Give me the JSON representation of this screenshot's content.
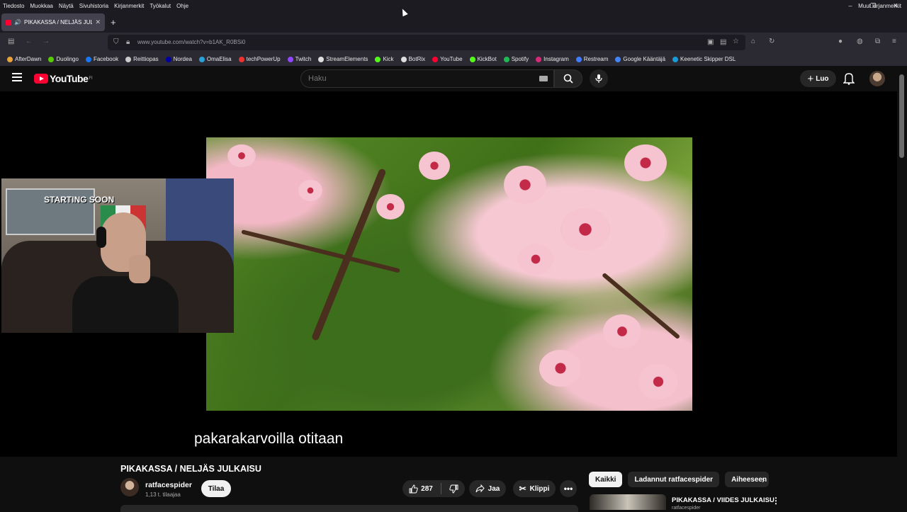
{
  "menubar": {
    "items": [
      "Tiedosto",
      "Muokkaa",
      "Näytä",
      "Sivuhistoria",
      "Kirjanmerkit",
      "Työkalut",
      "Ohje"
    ]
  },
  "window_controls": [
    "–",
    "❐",
    "✕"
  ],
  "tab": {
    "title": "PIKAKASSA / NELJÄS JULKAISU",
    "close": "✕"
  },
  "newtab": "+",
  "address": {
    "url": "www.youtube.com/watch?v=b1AK_R0BSi0"
  },
  "bookmarks": [
    {
      "label": "AfterDawn",
      "color": "#e8a33a"
    },
    {
      "label": "Duolingo",
      "color": "#58cc02"
    },
    {
      "label": "Facebook",
      "color": "#1877f2"
    },
    {
      "label": "Reittiopas",
      "color": "#cccccc"
    },
    {
      "label": "Nordea",
      "color": "#0000a0"
    },
    {
      "label": "OmaElisa",
      "color": "#2aa0d8"
    },
    {
      "label": "techPowerUp",
      "color": "#e33"
    },
    {
      "label": "Twitch",
      "color": "#9146ff"
    },
    {
      "label": "StreamElements",
      "color": "#dddddd"
    },
    {
      "label": "Kick",
      "color": "#53fc18"
    },
    {
      "label": "BotRix",
      "color": "#dddddd"
    },
    {
      "label": "YouTube",
      "color": "#ff0033"
    },
    {
      "label": "KickBot",
      "color": "#53fc18"
    },
    {
      "label": "Spotify",
      "color": "#1db954"
    },
    {
      "label": "Instagram",
      "color": "#d62976"
    },
    {
      "label": "Restream",
      "color": "#3f7cff"
    },
    {
      "label": "Google Kääntäjä",
      "color": "#4285f4"
    },
    {
      "label": "Keenetic Skipper DSL",
      "color": "#1a9ad6"
    }
  ],
  "bookmarks_other": "Muut kirjanmerkit",
  "youtube": {
    "logo": "YouTube",
    "region": "FI",
    "search_placeholder": "Haku",
    "create_label": "Luo"
  },
  "player": {
    "caption": "pakarakarvoilla otitaan",
    "webcam_poster_text": "STARTING SOON"
  },
  "video": {
    "title": "PIKAKASSA / NELJÄS JULKAISU",
    "channel": "ratfacespider",
    "subscribers": "1,13 t. tilaajaa",
    "subscribe_label": "Tilaa",
    "likes": "287",
    "share_label": "Jaa",
    "clip_label": "Klippi"
  },
  "sidebar": {
    "chips": [
      "Kaikki",
      "Ladannut ratfacespider",
      "Aiheeseen liittyvät"
    ],
    "recommendation": {
      "title": "PIKAKASSA / VIIDES JULKAISU",
      "channel": "ratfacespider"
    }
  }
}
